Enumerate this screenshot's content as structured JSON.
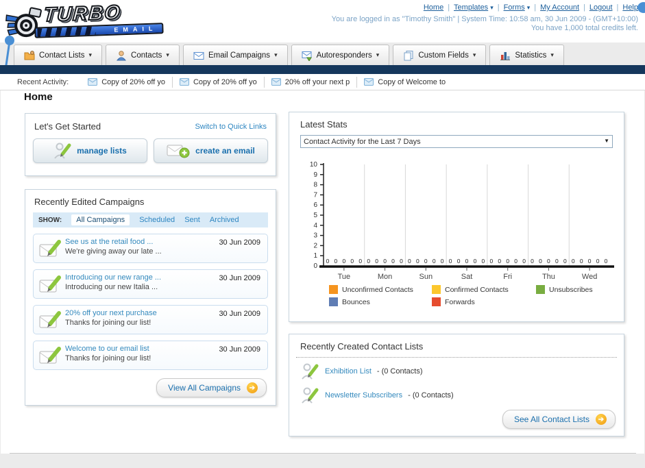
{
  "glyphs": {
    "pipe": "|",
    "dropdown": "▾",
    "arrow": "➔",
    "select_arrow": "▼"
  },
  "header": {
    "logo_line1": "TURBO",
    "logo_line2": "EMAIL",
    "nav_links": [
      "Home",
      "Templates",
      "Forms",
      "My Account",
      "Logout",
      "Help"
    ],
    "login_info": "You are logged in as \"Timothy Smith\" | System Time: 10:58 am, 30 Jun 2009 - (GMT+10:00)",
    "credits_info": "You have 1,000 total credits left."
  },
  "nav_tabs": [
    {
      "label": "Contact Lists"
    },
    {
      "label": "Contacts"
    },
    {
      "label": "Email Campaigns"
    },
    {
      "label": "Autoresponders"
    },
    {
      "label": "Custom Fields"
    },
    {
      "label": "Statistics"
    }
  ],
  "recent_activity": {
    "label": "Recent Activity:",
    "items": [
      "Copy of 20% off yo",
      "Copy of 20% off yo",
      "20% off your next p",
      "Copy of Welcome to"
    ]
  },
  "page_title": "Home",
  "get_started": {
    "title": "Let's Get Started",
    "switch_link": "Switch to Quick Links",
    "buttons": [
      {
        "label": "manage lists"
      },
      {
        "label": "create an email"
      }
    ]
  },
  "campaigns": {
    "title": "Recently Edited Campaigns",
    "show_label": "SHOW:",
    "filters": [
      "All Campaigns",
      "Scheduled",
      "Sent",
      "Archived"
    ],
    "active_filter": "All Campaigns",
    "items": [
      {
        "title": "See us at the retail food ...",
        "desc": "We're giving away our late ...",
        "date": "30 Jun 2009"
      },
      {
        "title": "Introducing our new range ...",
        "desc": "Introducing our new Italia ...",
        "date": "30 Jun 2009"
      },
      {
        "title": "20% off your next purchase",
        "desc": "Thanks for joining our list!",
        "date": "30 Jun 2009"
      },
      {
        "title": "Welcome to our email list",
        "desc": "Thanks for joining our list!",
        "date": "30 Jun 2009"
      }
    ],
    "view_all_label": "View All Campaigns"
  },
  "latest_stats": {
    "title": "Latest Stats",
    "selected_option": "Contact Activity for the Last 7 Days"
  },
  "chart_data": {
    "type": "bar",
    "title": "Contact Activity for the Last 7 Days",
    "categories": [
      "Tue",
      "Mon",
      "Sun",
      "Sat",
      "Fri",
      "Thu",
      "Wed"
    ],
    "series": [
      {
        "name": "Unconfirmed Contacts",
        "color": "#f5941f",
        "values": [
          0,
          0,
          0,
          0,
          0,
          0,
          0
        ]
      },
      {
        "name": "Confirmed Contacts",
        "color": "#fcc72d",
        "values": [
          0,
          0,
          0,
          0,
          0,
          0,
          0
        ]
      },
      {
        "name": "Unsubscribes",
        "color": "#79ad41",
        "values": [
          0,
          0,
          0,
          0,
          0,
          0,
          0
        ]
      },
      {
        "name": "Bounces",
        "color": "#5f7db4",
        "values": [
          0,
          0,
          0,
          0,
          0,
          0,
          0
        ]
      },
      {
        "name": "Forwards",
        "color": "#e64c2e",
        "values": [
          0,
          0,
          0,
          0,
          0,
          0,
          0
        ]
      }
    ],
    "ylim": [
      0,
      10
    ],
    "yticks": [
      0,
      1,
      2,
      3,
      4,
      5,
      6,
      7,
      8,
      9,
      10
    ],
    "xlabel": "",
    "ylabel": "",
    "grid": true,
    "legend_position": "bottom"
  },
  "contact_lists": {
    "title": "Recently Created Contact Lists",
    "items": [
      {
        "name": "Exhibition List",
        "detail": "- (0 Contacts)"
      },
      {
        "name": "Newsletter Subscribers",
        "detail": "- (0 Contacts)"
      }
    ],
    "see_all_label": "See All Contact Lists"
  },
  "colors": {
    "navy_bar": "#15375c",
    "link_blue": "#2e86c1",
    "accent_orange": "#f0a51f",
    "logo_blue": "#1a49ae"
  }
}
